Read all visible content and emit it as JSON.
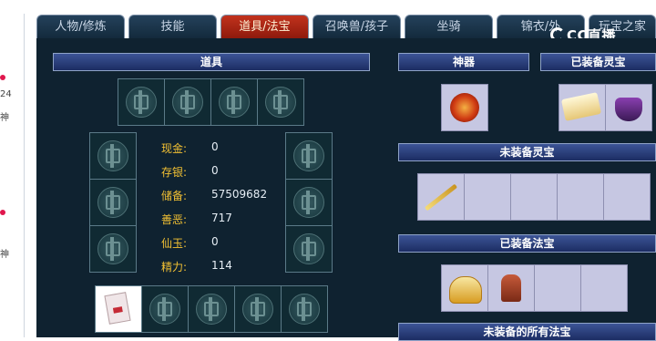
{
  "left_strip": {
    "texts": [
      "24",
      "神",
      "神"
    ]
  },
  "tabs": [
    {
      "label": "人物/修炼",
      "active": false
    },
    {
      "label": "技能",
      "active": false
    },
    {
      "label": "道具/法宝",
      "active": true
    },
    {
      "label": "召唤兽/孩子",
      "active": false
    },
    {
      "label": "坐骑",
      "active": false
    },
    {
      "label": "锦衣/外",
      "active": false
    },
    {
      "label": "玩宝之家",
      "active": false
    }
  ],
  "watermark": {
    "text": "CC直播"
  },
  "sections": {
    "items": "道具",
    "artifact": "神器",
    "equipped_spirit": "已装备灵宝",
    "unequipped_spirit": "未装备灵宝",
    "equipped_magic": "已装备法宝",
    "unequipped_all_magic": "未装备的所有法宝"
  },
  "stats": [
    {
      "label": "现金:",
      "value": "0"
    },
    {
      "label": "存银:",
      "value": "0"
    },
    {
      "label": "储备:",
      "value": "57509682"
    },
    {
      "label": "善恶:",
      "value": "717"
    },
    {
      "label": "仙玉:",
      "value": "0"
    },
    {
      "label": "精力:",
      "value": "114"
    }
  ],
  "colors": {
    "panel_bg": "#0f2230",
    "header_blue": "#2b417a",
    "active_tab": "#b52a17",
    "label_gold": "#f2c033",
    "slot_lavender": "#c6c7e2"
  },
  "icons": {
    "empty_slot": "seal-emblem-icon",
    "artifact": "fire-orb-icon",
    "spirit_1": "scroll-icon",
    "spirit_2": "cauldron-icon",
    "unequipped_spirit_1": "golden-rod-icon",
    "magic_1": "golden-fan-icon",
    "magic_2": "seal-stamp-icon",
    "item_1": "card-item-icon"
  }
}
